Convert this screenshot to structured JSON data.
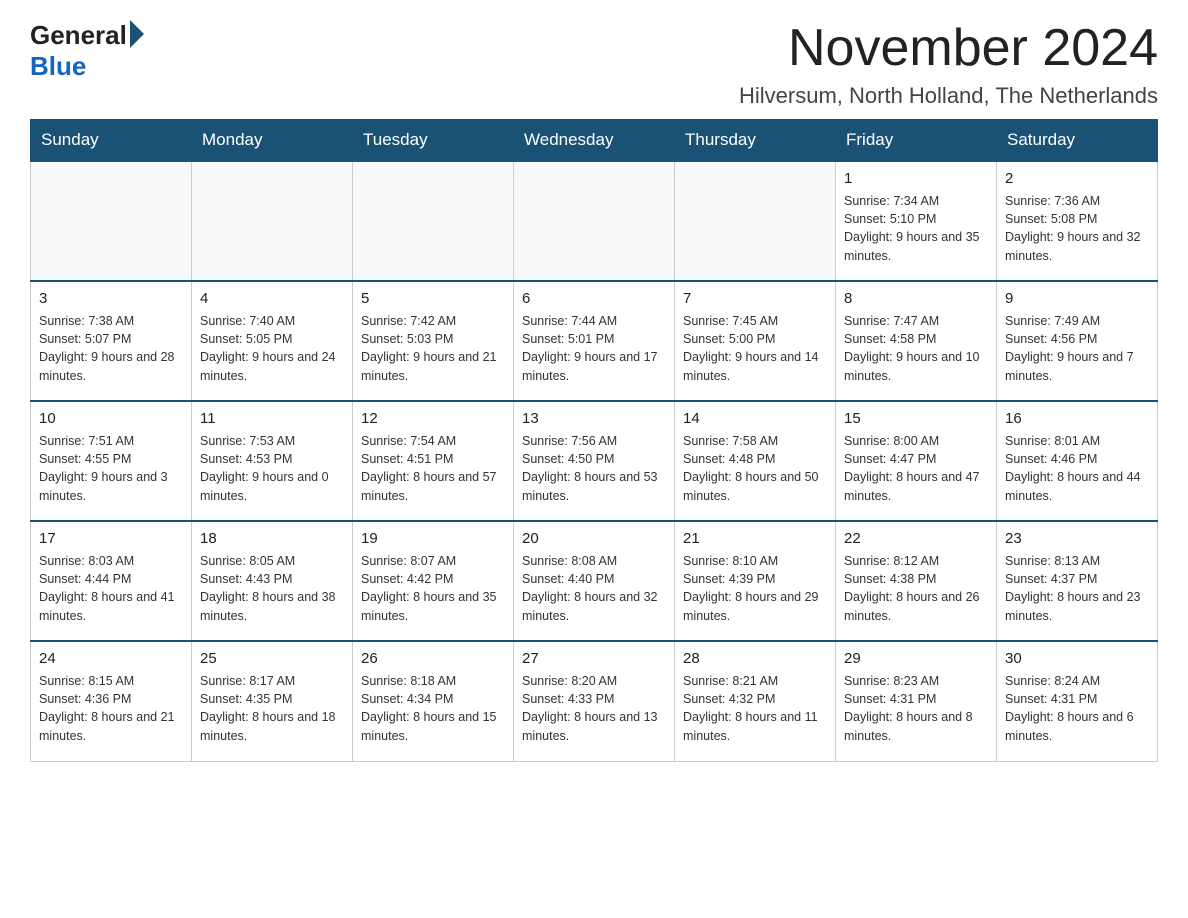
{
  "logo": {
    "general": "General",
    "blue": "Blue"
  },
  "title": {
    "month": "November 2024",
    "location": "Hilversum, North Holland, The Netherlands"
  },
  "weekdays": [
    "Sunday",
    "Monday",
    "Tuesday",
    "Wednesday",
    "Thursday",
    "Friday",
    "Saturday"
  ],
  "weeks": [
    [
      {
        "day": "",
        "info": ""
      },
      {
        "day": "",
        "info": ""
      },
      {
        "day": "",
        "info": ""
      },
      {
        "day": "",
        "info": ""
      },
      {
        "day": "",
        "info": ""
      },
      {
        "day": "1",
        "info": "Sunrise: 7:34 AM\nSunset: 5:10 PM\nDaylight: 9 hours and 35 minutes."
      },
      {
        "day": "2",
        "info": "Sunrise: 7:36 AM\nSunset: 5:08 PM\nDaylight: 9 hours and 32 minutes."
      }
    ],
    [
      {
        "day": "3",
        "info": "Sunrise: 7:38 AM\nSunset: 5:07 PM\nDaylight: 9 hours and 28 minutes."
      },
      {
        "day": "4",
        "info": "Sunrise: 7:40 AM\nSunset: 5:05 PM\nDaylight: 9 hours and 24 minutes."
      },
      {
        "day": "5",
        "info": "Sunrise: 7:42 AM\nSunset: 5:03 PM\nDaylight: 9 hours and 21 minutes."
      },
      {
        "day": "6",
        "info": "Sunrise: 7:44 AM\nSunset: 5:01 PM\nDaylight: 9 hours and 17 minutes."
      },
      {
        "day": "7",
        "info": "Sunrise: 7:45 AM\nSunset: 5:00 PM\nDaylight: 9 hours and 14 minutes."
      },
      {
        "day": "8",
        "info": "Sunrise: 7:47 AM\nSunset: 4:58 PM\nDaylight: 9 hours and 10 minutes."
      },
      {
        "day": "9",
        "info": "Sunrise: 7:49 AM\nSunset: 4:56 PM\nDaylight: 9 hours and 7 minutes."
      }
    ],
    [
      {
        "day": "10",
        "info": "Sunrise: 7:51 AM\nSunset: 4:55 PM\nDaylight: 9 hours and 3 minutes."
      },
      {
        "day": "11",
        "info": "Sunrise: 7:53 AM\nSunset: 4:53 PM\nDaylight: 9 hours and 0 minutes."
      },
      {
        "day": "12",
        "info": "Sunrise: 7:54 AM\nSunset: 4:51 PM\nDaylight: 8 hours and 57 minutes."
      },
      {
        "day": "13",
        "info": "Sunrise: 7:56 AM\nSunset: 4:50 PM\nDaylight: 8 hours and 53 minutes."
      },
      {
        "day": "14",
        "info": "Sunrise: 7:58 AM\nSunset: 4:48 PM\nDaylight: 8 hours and 50 minutes."
      },
      {
        "day": "15",
        "info": "Sunrise: 8:00 AM\nSunset: 4:47 PM\nDaylight: 8 hours and 47 minutes."
      },
      {
        "day": "16",
        "info": "Sunrise: 8:01 AM\nSunset: 4:46 PM\nDaylight: 8 hours and 44 minutes."
      }
    ],
    [
      {
        "day": "17",
        "info": "Sunrise: 8:03 AM\nSunset: 4:44 PM\nDaylight: 8 hours and 41 minutes."
      },
      {
        "day": "18",
        "info": "Sunrise: 8:05 AM\nSunset: 4:43 PM\nDaylight: 8 hours and 38 minutes."
      },
      {
        "day": "19",
        "info": "Sunrise: 8:07 AM\nSunset: 4:42 PM\nDaylight: 8 hours and 35 minutes."
      },
      {
        "day": "20",
        "info": "Sunrise: 8:08 AM\nSunset: 4:40 PM\nDaylight: 8 hours and 32 minutes."
      },
      {
        "day": "21",
        "info": "Sunrise: 8:10 AM\nSunset: 4:39 PM\nDaylight: 8 hours and 29 minutes."
      },
      {
        "day": "22",
        "info": "Sunrise: 8:12 AM\nSunset: 4:38 PM\nDaylight: 8 hours and 26 minutes."
      },
      {
        "day": "23",
        "info": "Sunrise: 8:13 AM\nSunset: 4:37 PM\nDaylight: 8 hours and 23 minutes."
      }
    ],
    [
      {
        "day": "24",
        "info": "Sunrise: 8:15 AM\nSunset: 4:36 PM\nDaylight: 8 hours and 21 minutes."
      },
      {
        "day": "25",
        "info": "Sunrise: 8:17 AM\nSunset: 4:35 PM\nDaylight: 8 hours and 18 minutes."
      },
      {
        "day": "26",
        "info": "Sunrise: 8:18 AM\nSunset: 4:34 PM\nDaylight: 8 hours and 15 minutes."
      },
      {
        "day": "27",
        "info": "Sunrise: 8:20 AM\nSunset: 4:33 PM\nDaylight: 8 hours and 13 minutes."
      },
      {
        "day": "28",
        "info": "Sunrise: 8:21 AM\nSunset: 4:32 PM\nDaylight: 8 hours and 11 minutes."
      },
      {
        "day": "29",
        "info": "Sunrise: 8:23 AM\nSunset: 4:31 PM\nDaylight: 8 hours and 8 minutes."
      },
      {
        "day": "30",
        "info": "Sunrise: 8:24 AM\nSunset: 4:31 PM\nDaylight: 8 hours and 6 minutes."
      }
    ]
  ]
}
